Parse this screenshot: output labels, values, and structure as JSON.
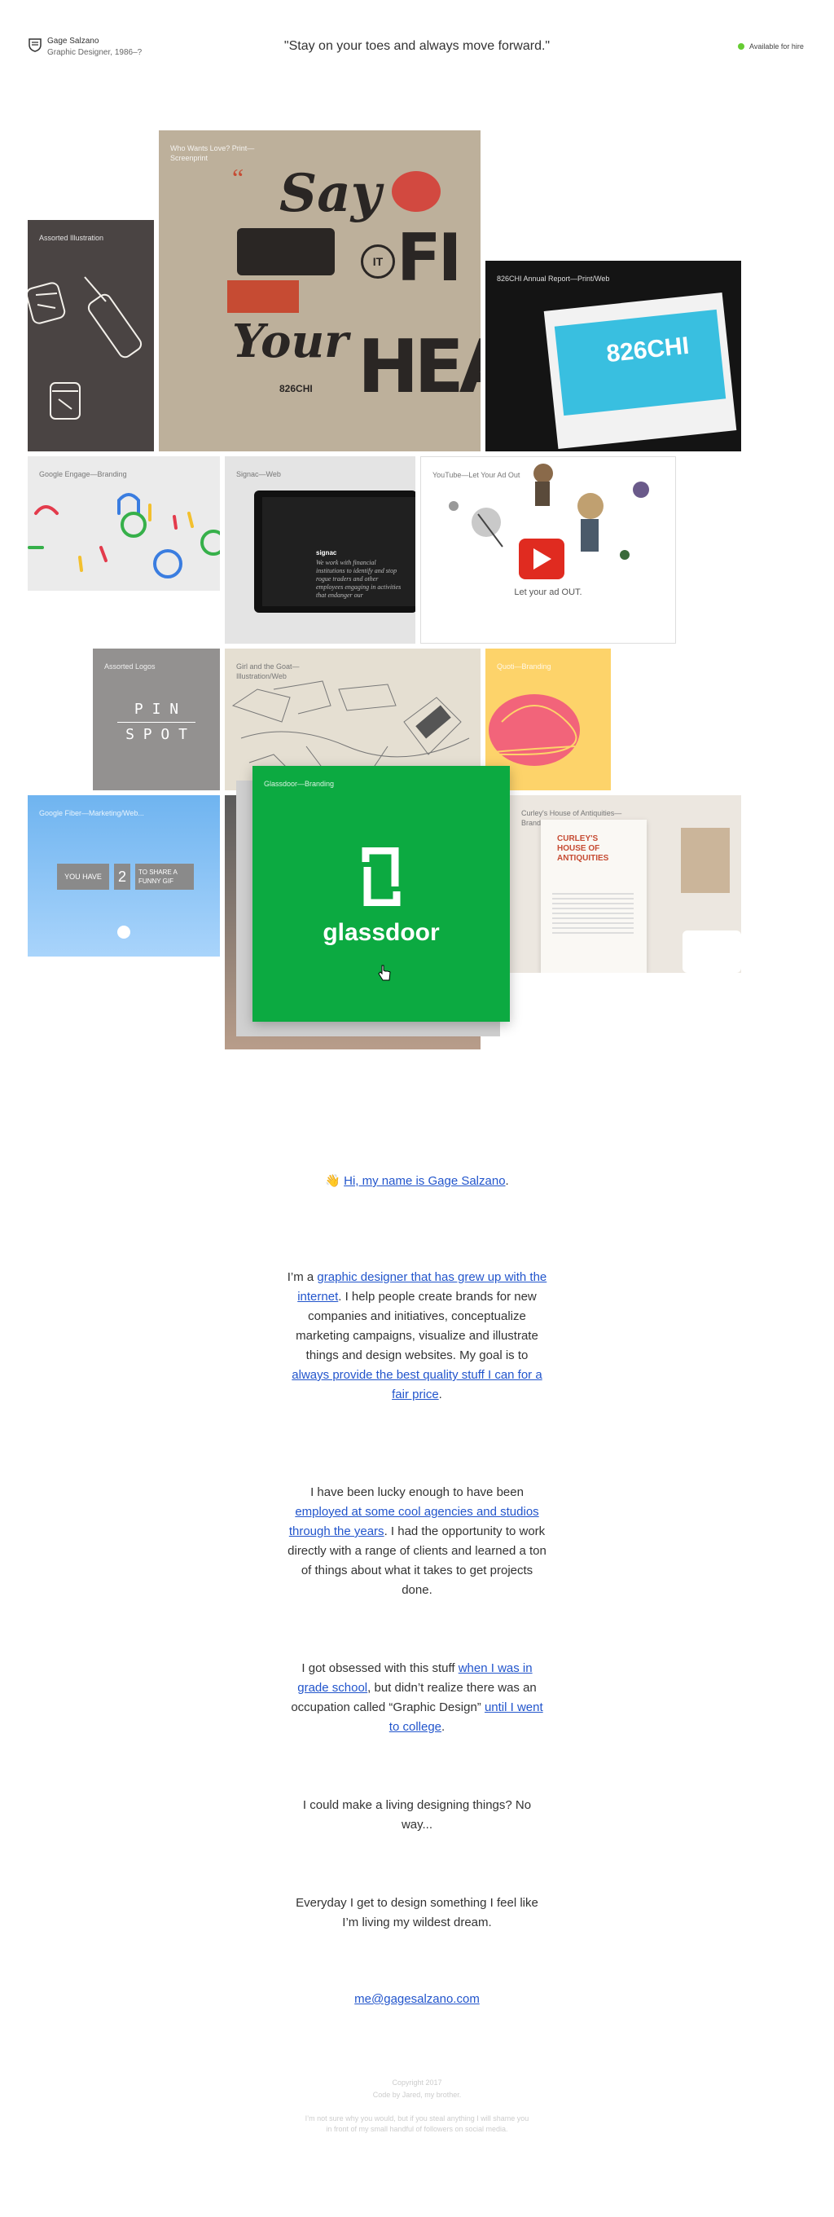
{
  "header": {
    "name": "Gage Salzano",
    "subtitle": "Graphic Designer, 1986–?",
    "quote": "\"Stay on your toes and always move forward.\"",
    "status": "Available for hire",
    "status_color": "#66cc33"
  },
  "tiles": {
    "illustration": "Assorted Illustration",
    "print": "Who Wants Love? Print—Screenprint",
    "chi": "826CHI Annual Report—Print/Web",
    "google": "Google Engage—Branding",
    "signac": "Signac—Web",
    "youtube": "YouTube—Let Your Ad Out",
    "logos": "Assorted Logos",
    "girl": "Girl and the Goat— Illustration/Web",
    "quoti": "Quoti—Branding",
    "fiber": "Google Fiber—Marketing/Web...",
    "glassdoor": "Glassdoor—Branding",
    "curley": "Curley's House of Antiquities—Branding"
  },
  "art": {
    "say": "Say",
    "your": "Your",
    "fi": "FI",
    "hea": "HEA",
    "it": "IT",
    "chi_word": "826CHI",
    "pin": "P I N",
    "spot": "S P O T",
    "you_have": "YOU HAVE",
    "two": "2",
    "share": "TO SHARE A FUNNY GIF",
    "glassdoor_word": "glassdoor",
    "curley_title": "CURLEY'S HOUSE OF ANTIQUITIES",
    "youtube_caption": "Let your ad OUT.",
    "signac_name": "signac",
    "signac_text": "We work with financial institutions to identify and stop rogue traders and other employees engaging in activities that endanger our"
  },
  "intro": {
    "wave": "👋",
    "hi": "Hi, my name is Gage Salzano"
  },
  "p1": {
    "a": "I’m a ",
    "link1": "graphic designer that has grew up with the internet",
    "b": ". I help people create brands for new companies and initiatives, conceptualize marketing campaigns, visualize and illustrate things and design websites. My goal is to ",
    "link2": "always provide the best quality stuff I can for a fair price",
    "c": "."
  },
  "p2": {
    "a": "I have been lucky enough to have been ",
    "link1": "employed at some cool agencies and studios through the years",
    "b": ". I had the opportunity to work directly with a range of clients and learned a ton of things about what it takes to get projects done."
  },
  "p3": {
    "a": "I got obsessed with this stuff ",
    "link1": "when I was in grade school",
    "b": ", but didn’t realize there was an occupation called “Graphic Design” ",
    "link2": "until I went to college",
    "c": "."
  },
  "p4": "I could make a living designing things? No way...",
  "p5": "Everyday I get to design something I feel like I’m living my wildest dream.",
  "contact": {
    "email": "me@gagesalzano.com"
  },
  "footer": {
    "copyright": "Copyright 2017",
    "code": "Code by Jared, my brother.",
    "disclaimer": "I’m not sure why you would, but if you steal anything I will shame you in front of my small handful of followers on social media."
  },
  "colors": {
    "link": "#2255cc",
    "glassdoor": "#0caa41",
    "quoti": "#fdd36a",
    "fiber": "#7fbef5"
  }
}
